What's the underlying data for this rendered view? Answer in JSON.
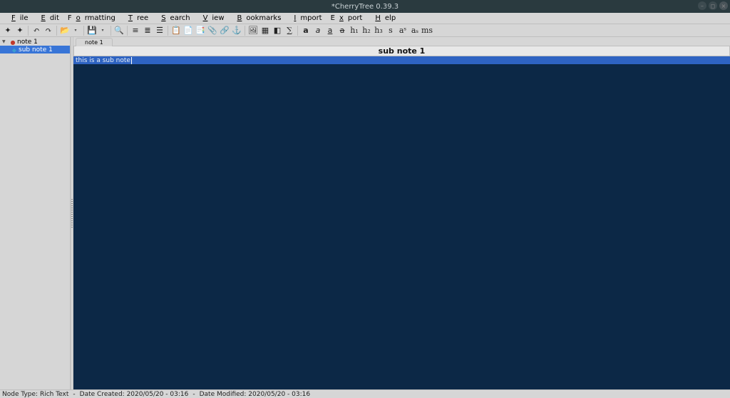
{
  "window": {
    "title": "*CherryTree 0.39.3"
  },
  "menubar": {
    "items": [
      "File",
      "Edit",
      "Formatting",
      "Tree",
      "Search",
      "View",
      "Bookmarks",
      "Import",
      "Export",
      "Help"
    ],
    "mnemonic_index": [
      0,
      0,
      1,
      0,
      0,
      0,
      0,
      0,
      1,
      0
    ]
  },
  "toolbar_groups": [
    [
      "node-add",
      "node-remove"
    ],
    [
      "undo",
      "redo"
    ],
    [
      "open",
      "dropdown-arrow"
    ],
    [
      "save",
      "dropdown-arrow"
    ],
    [
      "find"
    ],
    [
      "list-bullet",
      "list-number",
      "list-todo"
    ],
    [
      "copy",
      "paste",
      "clipboard",
      "attach",
      "link",
      "anchor"
    ],
    [
      "image",
      "table",
      "codebox",
      "equation"
    ],
    [
      "format-bold",
      "format-italic",
      "format-underline",
      "format-strikethrough",
      "h1",
      "h2",
      "h3",
      "small",
      "superscript",
      "subscript",
      "monospace"
    ]
  ],
  "toolbar_glyphs": {
    "node-add": "✦",
    "node-remove": "✦",
    "undo": "↶",
    "redo": "↷",
    "open": "📂",
    "save": "💾",
    "find": "🔍",
    "list-bullet": "≡",
    "list-number": "≣",
    "list-todo": "☰",
    "copy": "📋",
    "paste": "📄",
    "clipboard": "📑",
    "attach": "📎",
    "link": "🔗",
    "anchor": "⚓",
    "image": "🖼",
    "table": "▦",
    "codebox": "◧",
    "equation": "∑",
    "format-bold": "a",
    "format-italic": "a",
    "format-underline": "a",
    "format-strikethrough": "a",
    "h1": "h₁",
    "h2": "h₂",
    "h3": "h₃",
    "small": "s",
    "superscript": "aˢ",
    "subscript": "aₛ",
    "monospace": "ms",
    "dropdown-arrow": "▾"
  },
  "tree": {
    "root": {
      "label": "note 1",
      "expanded": true
    },
    "child": {
      "label": "sub note 1",
      "selected": true
    }
  },
  "tabs": [
    {
      "label": "note 1"
    }
  ],
  "node_header": "sub note 1",
  "editor": {
    "text": "this is a sub note"
  },
  "statusbar": {
    "node_type_label": "Node Type:",
    "node_type_value": "Rich Text",
    "date_created_label": "Date Created:",
    "date_created_value": "2020/05/20 - 03:16",
    "date_modified_label": "Date Modified:",
    "date_modified_value": "2020/05/20 - 03:16",
    "sep": "-"
  }
}
